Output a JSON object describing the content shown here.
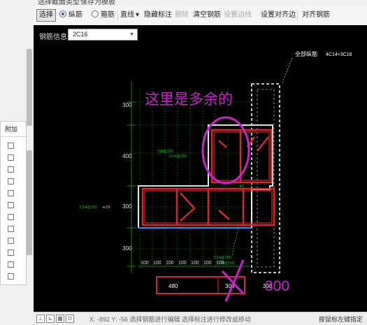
{
  "top_menu": {
    "section_type": "选择截面类型",
    "save_template": "保存为模板"
  },
  "toolbar": {
    "select": "选择",
    "longitudinal": "纵筋",
    "stirrup": "箍筋",
    "line": "直线",
    "hide_annotation": "隐藏标注",
    "delete": "删除",
    "clear_rebar": "清空钢筋",
    "set_edge_line": "设置边线",
    "set_align_edge": "设置对齐边",
    "align_rebar": "对齐钢筋"
  },
  "rebar_info": {
    "label": "钢筋信息:",
    "value": "2C16"
  },
  "drawing": {
    "all_longitudinal": "全部纵筋",
    "all_longitudinal_value": "4C14+3C16",
    "dim_left": [
      "300",
      "400",
      "300",
      "300"
    ],
    "dim_bottom": [
      "100",
      "100",
      "100",
      "100",
      "100",
      "100",
      "100"
    ],
    "left_callout": "C14@150",
    "left_callout_suffix": "·sc10·",
    "mid_callout": "C8@200",
    "mid_callout2": "C14@150",
    "right_callout": "C14@150",
    "right_callout2": "C14@150",
    "green_tag": "4C",
    "box_dims": [
      "480",
      "300",
      "300"
    ],
    "colors": {
      "rebar": "#d42a2a",
      "section": "#ffffff",
      "hint_line": "#2a8cff",
      "grid": "#0b8a0b"
    }
  },
  "annotations": {
    "note": "这里是多余的",
    "correction": "300",
    "color": "#cc22cc"
  },
  "left_panel": {
    "header": "附加"
  },
  "statusbar": {
    "text": "X: -892 Y: -56 选择钢筋进行编辑    选择标注进行修改或移动",
    "right": "按鼠标左键指定"
  }
}
